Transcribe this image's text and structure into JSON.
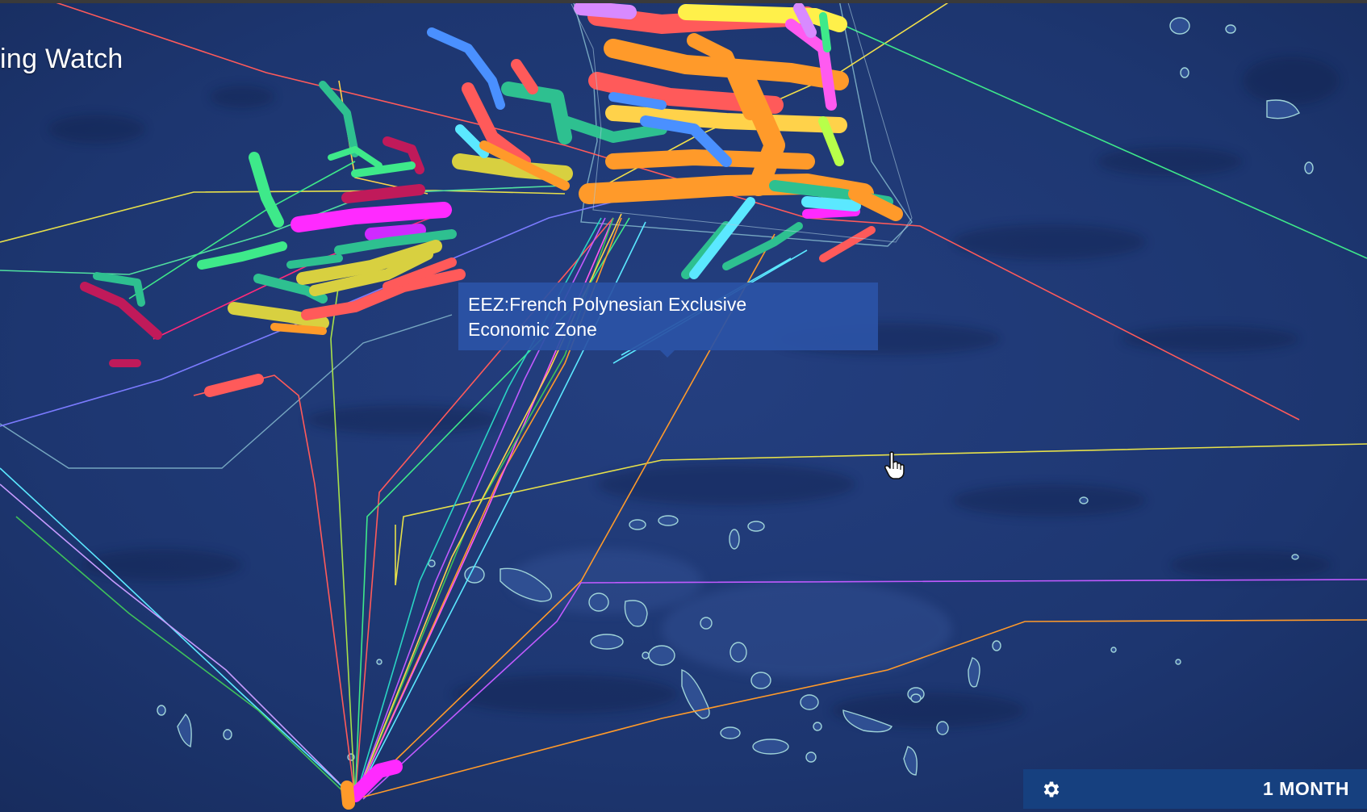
{
  "app": {
    "title": "ing Watch"
  },
  "tooltip": {
    "line1": "EEZ:French Polynesian Exclusive",
    "line2": "Economic Zone"
  },
  "time_control": {
    "range_label": "1 MONTH",
    "settings_icon": "gear-icon"
  },
  "colors": {
    "ocean": "#1f3a78",
    "tooltip_bg": "#2b53a6",
    "timebar_bg": "#16407f",
    "eez_outline": "#8fc3d6"
  }
}
